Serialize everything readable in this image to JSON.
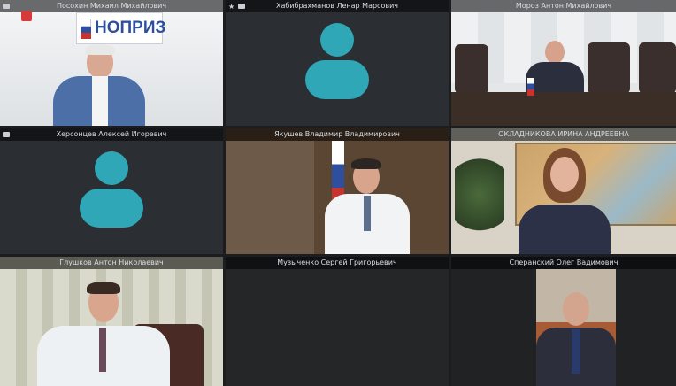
{
  "participants": [
    {
      "name": "Посохин Михаил Михайлович",
      "type": "video",
      "brand_text": "НОПРИЗ"
    },
    {
      "name": "Хабибрахманов Ленар Марсович",
      "type": "avatar"
    },
    {
      "name": "Мороз Антон Михайлович",
      "type": "video"
    },
    {
      "name": "Херсонцев Алексей Игоревич",
      "type": "avatar"
    },
    {
      "name": "Якушев Владимир Владимирович",
      "type": "video"
    },
    {
      "name": "ОКЛАДНИКОВА ИРИНА АНДРЕЕВНА",
      "type": "video"
    },
    {
      "name": "Глушков Антон Николаевич",
      "type": "video"
    },
    {
      "name": "Музыченко Сергей Григорьевич",
      "type": "blank"
    },
    {
      "name": "Сперанский Олег Вадимович",
      "type": "video"
    }
  ],
  "colors": {
    "avatar_teal": "#2fa7b6",
    "tile_dark": "#2b2f33",
    "accent_red": "#d63a3a",
    "brand_blue": "#2d4f9e"
  }
}
